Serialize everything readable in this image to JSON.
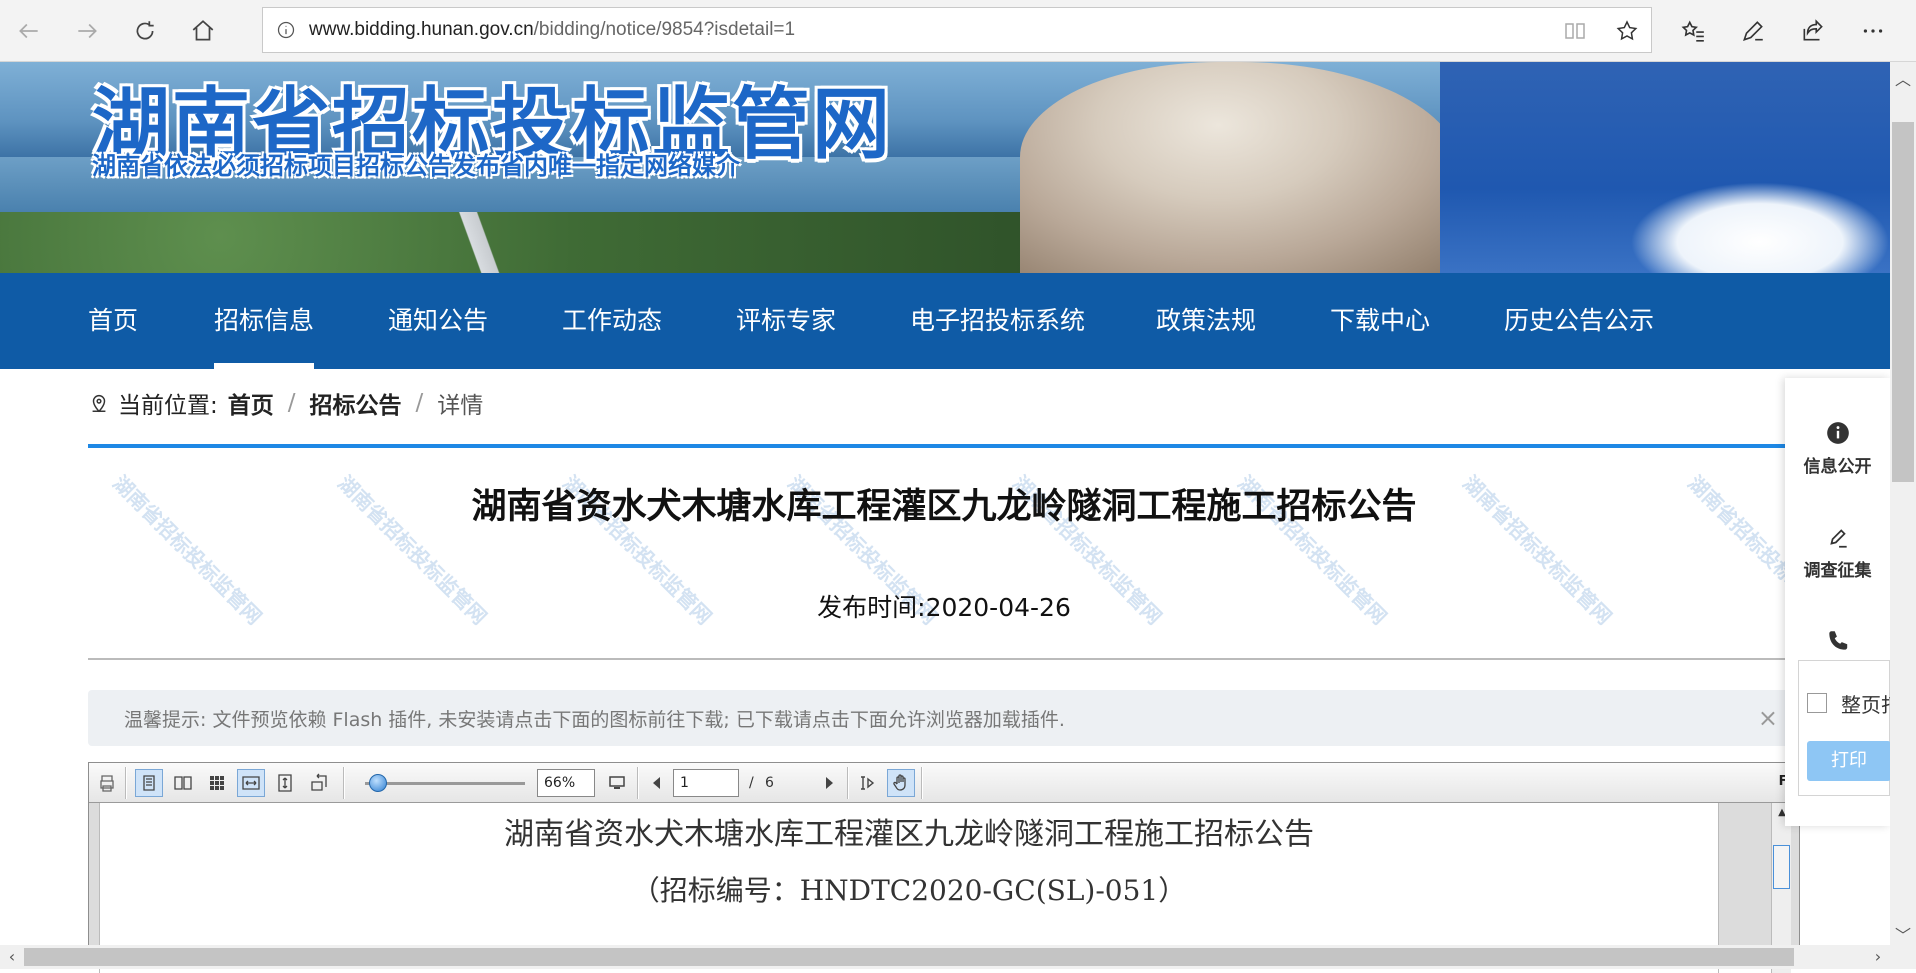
{
  "browser": {
    "url_host": "www.bidding.hunan.gov.cn",
    "url_path": "/bidding/notice/9854?isdetail=1"
  },
  "banner": {
    "title": "湖南省招标投标监管网",
    "subtitle": "湖南省依法必须招标项目招标公告发布省内唯一指定网络媒介"
  },
  "nav": {
    "items": [
      "首页",
      "招标信息",
      "通知公告",
      "工作动态",
      "评标专家",
      "电子招投标系统",
      "政策法规",
      "下载中心",
      "历史公告公示"
    ],
    "active": "招标信息"
  },
  "breadcrumb": {
    "label": "当前位置:",
    "home": "首页",
    "section": "招标公告",
    "current": "详情",
    "separator": "/"
  },
  "watermark_text": "湖南省招标投标监管网",
  "notice": {
    "title": "湖南省资水犬木塘水库工程灌区九龙岭隧洞工程施工招标公告",
    "publish_date": "发布时间:2020-04-26"
  },
  "tip": {
    "text": "温馨提示: 文件预览依赖 Flash 插件, 未安装请点击下面的图标前往下载; 已下载请点击下面允许浏览器加载插件.",
    "close": "×"
  },
  "viewer": {
    "zoom": "66%",
    "page_current": "1",
    "page_sep": "/",
    "page_total": "6",
    "fp_label": "FP",
    "page_line1": "湖南省资水犬木塘水库工程灌区九龙岭隧洞工程施工招标公告",
    "page_line2": "（招标编号：HNDTC2020-GC(SL)-051）"
  },
  "side_panel": {
    "info": "信息公开",
    "survey": "调查征集",
    "fullpage": "整页打",
    "print": "打印"
  }
}
